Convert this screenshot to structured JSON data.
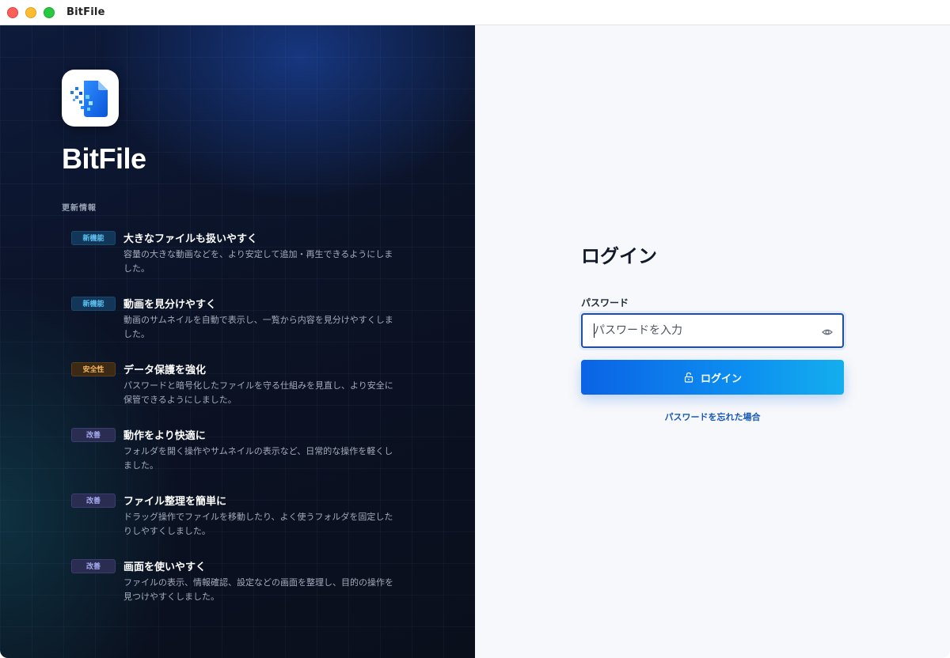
{
  "window": {
    "title": "BitFile"
  },
  "left_panel": {
    "brand": "BitFile",
    "updates_heading": "更新情報",
    "updates": [
      {
        "badge": "新機能",
        "badge_type": "new",
        "title": "大きなファイルも扱いやすく",
        "description": "容量の大きな動画などを、より安定して追加・再生できるようにしました。"
      },
      {
        "badge": "新機能",
        "badge_type": "new",
        "title": "動画を見分けやすく",
        "description": "動画のサムネイルを自動で表示し、一覧から内容を見分けやすくしました。"
      },
      {
        "badge": "安全性",
        "badge_type": "security",
        "title": "データ保護を強化",
        "description": "パスワードと暗号化したファイルを守る仕組みを見直し、より安全に保管できるようにしました。"
      },
      {
        "badge": "改善",
        "badge_type": "improve",
        "title": "動作をより快適に",
        "description": "フォルダを開く操作やサムネイルの表示など、日常的な操作を軽くしました。"
      },
      {
        "badge": "改善",
        "badge_type": "improve",
        "title": "ファイル整理を簡単に",
        "description": "ドラッグ操作でファイルを移動したり、よく使うフォルダを固定したりしやすくしました。"
      },
      {
        "badge": "改善",
        "badge_type": "improve",
        "title": "画面を使いやすく",
        "description": "ファイルの表示、情報確認、設定などの画面を整理し、目的の操作を見つけやすくしました。"
      }
    ]
  },
  "login": {
    "title": "ログイン",
    "password_label": "パスワード",
    "password_value": "",
    "password_placeholder": "パスワードを入力",
    "submit_label": "ログイン",
    "forgot_link": "パスワードを忘れた場合"
  },
  "colors": {
    "accent": "#0b63e5",
    "accent_end": "#14aeee",
    "link": "#1858b8",
    "left_bg": "#0b1225",
    "right_bg": "#f7f8fb"
  },
  "icons": {
    "app_icon": "bitfile-app-icon",
    "password_toggle": "eye-icon",
    "login_button": "unlock-icon"
  }
}
